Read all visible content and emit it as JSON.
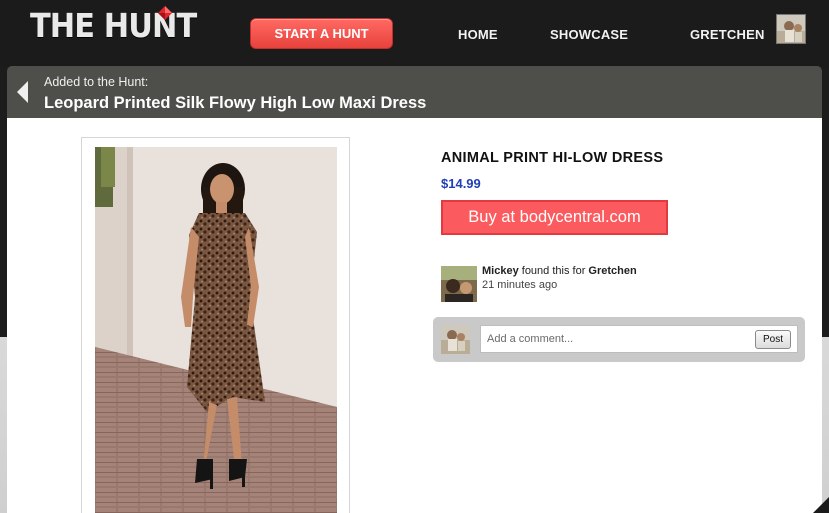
{
  "nav": {
    "logo_text": "THE HUNT",
    "start_label": "START A HUNT",
    "home_label": "HOME",
    "showcase_label": "SHOWCASE",
    "user_label": "GRETCHEN"
  },
  "header": {
    "added_label": "Added to the Hunt:",
    "title": "Leopard Printed Silk Flowy High Low Maxi Dress"
  },
  "product": {
    "name": "ANIMAL PRINT HI-LOW DRESS",
    "price": "$14.99",
    "buy_label": "Buy at bodycentral.com"
  },
  "finder": {
    "name": "Mickey",
    "connector": " found this for ",
    "recipient": "Gretchen",
    "time": "21 minutes ago"
  },
  "comment": {
    "placeholder": "Add a comment...",
    "post_label": "Post"
  },
  "colors": {
    "accent_red": "#fb5b5e",
    "price_blue": "#1f3fb6",
    "header_band": "#4e4e4a",
    "topbar": "#1b1b1b"
  },
  "icons": {
    "back": "back-arrow-icon",
    "logo_gem": "gem-icon"
  }
}
